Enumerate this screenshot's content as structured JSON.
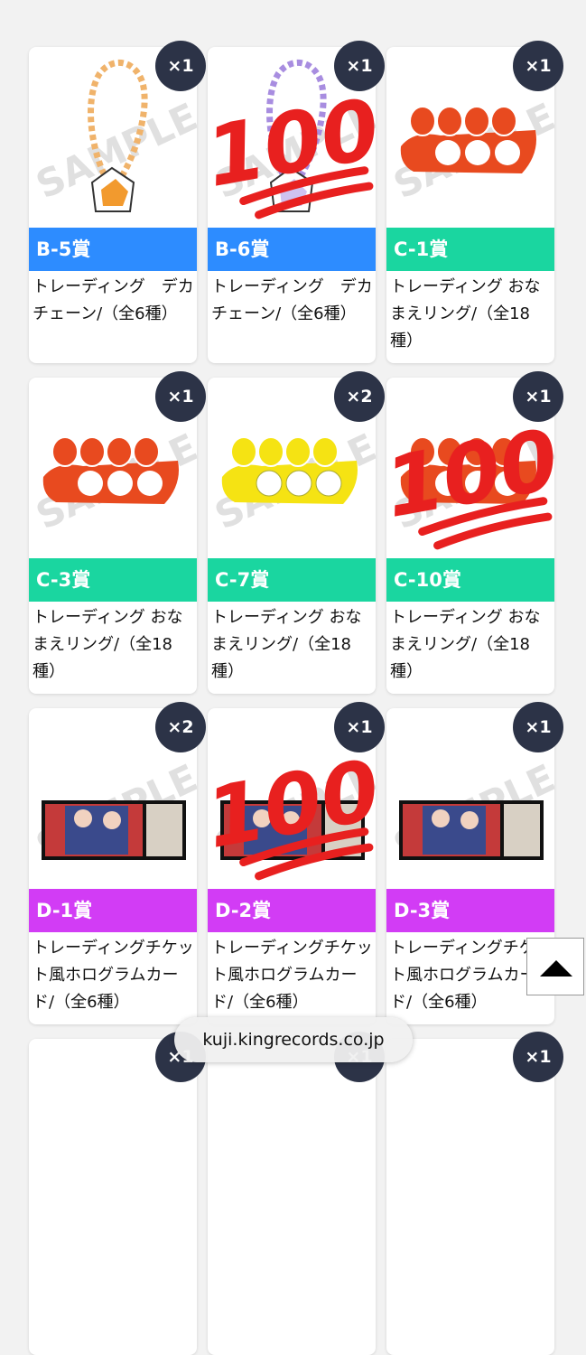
{
  "colors": {
    "blue": "#2d8cff",
    "teal": "#1ad6a0",
    "purple": "#d23cf5",
    "badge": "#2c3347",
    "sticker_red": "#e8201f"
  },
  "watermark": "SAMPLE",
  "prizes": [
    {
      "rank": "B-5賞",
      "desc": "トレーディング　デカチェーン/（全6種）",
      "qty": "×1",
      "color": "blue",
      "kind": "chain"
    },
    {
      "rank": "B-6賞",
      "desc": "トレーディング　デカチェーン/（全6種）",
      "qty": "×1",
      "color": "blue",
      "kind": "chain-hidden"
    },
    {
      "rank": "C-1賞",
      "desc": "トレーディング おなまえリング/（全18種）",
      "qty": "×1",
      "color": "teal",
      "kind": "ring"
    },
    {
      "rank": "C-3賞",
      "desc": "トレーディング おなまえリング/（全18種）",
      "qty": "×1",
      "color": "teal",
      "kind": "ring"
    },
    {
      "rank": "C-7賞",
      "desc": "トレーディング おなまえリング/（全18種）",
      "qty": "×2",
      "color": "teal",
      "kind": "ring-yellow"
    },
    {
      "rank": "C-10賞",
      "desc": "トレーディング おなまえリング/（全18種）",
      "qty": "×1",
      "color": "teal",
      "kind": "ring-hidden"
    },
    {
      "rank": "D-1賞",
      "desc": "トレーディングチケット風ホログラムカード/（全6種）",
      "qty": "×2",
      "color": "purple",
      "kind": "ticket"
    },
    {
      "rank": "D-2賞",
      "desc": "トレーディングチケット風ホログラムカード/（全6種）",
      "qty": "×1",
      "color": "purple",
      "kind": "ticket-hidden"
    },
    {
      "rank": "D-3賞",
      "desc": "トレーディングチケット風ホログラムカード/（全6種）",
      "qty": "×1",
      "color": "purple",
      "kind": "ticket"
    }
  ],
  "bottom_row_qty": [
    "×1",
    "×1",
    "×1"
  ],
  "sticker_text": "100",
  "browser": {
    "url": "kuji.kingrecords.co.jp"
  },
  "scroll_top_icon": "triangle-up-icon"
}
